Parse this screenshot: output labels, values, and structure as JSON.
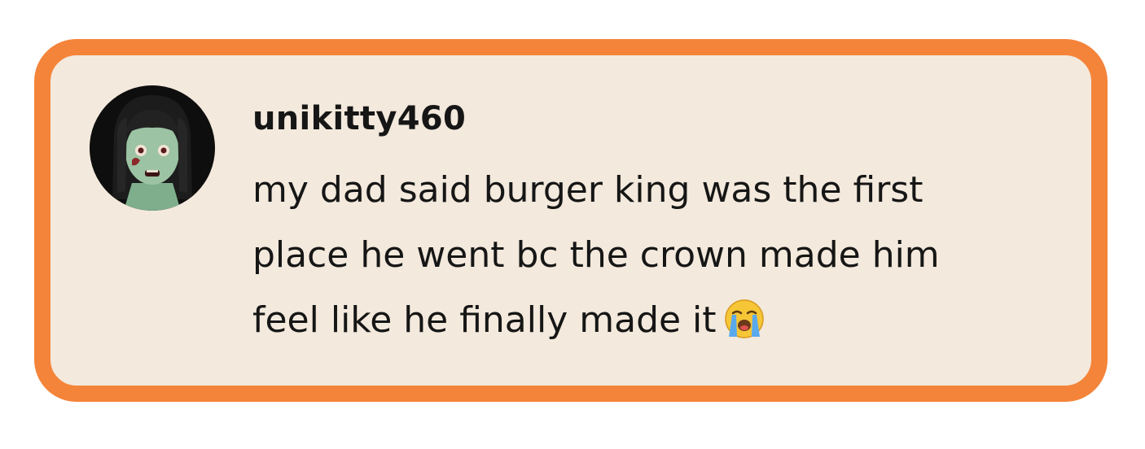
{
  "comment": {
    "username": "unikitty460",
    "lines": [
      "my dad said burger king was the first",
      "place he went bc the crown made him",
      "feel like he finally made it"
    ],
    "emoji": "loudly-crying-face-emoji"
  },
  "colors": {
    "border": "#f4843a",
    "card_background": "#f3e9dc",
    "text": "#161616"
  },
  "avatar": {
    "icon": "zombie-woman-emoji-avatar"
  }
}
